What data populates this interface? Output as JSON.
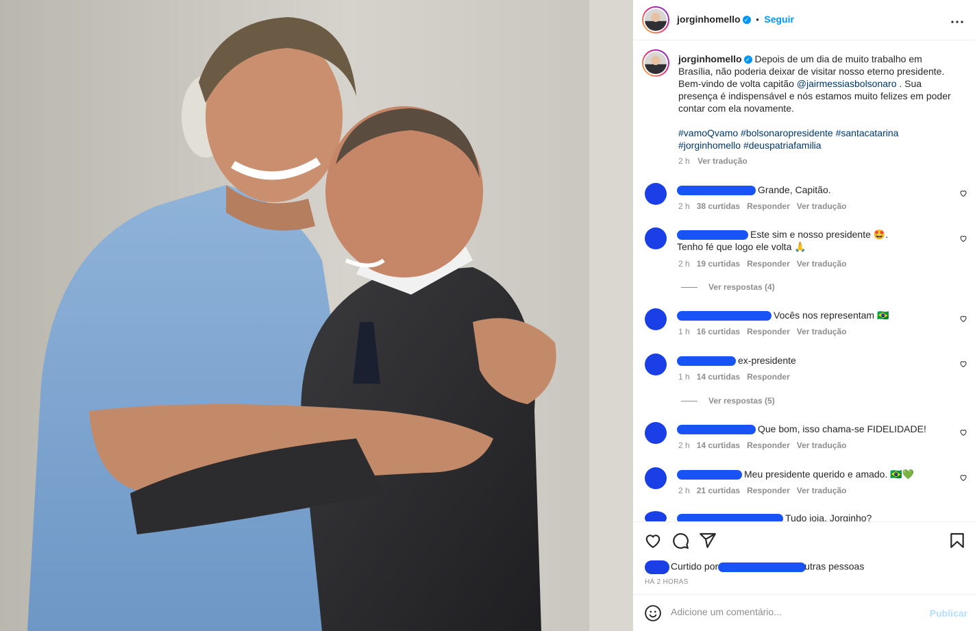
{
  "post": {
    "username": "jorginhomello",
    "follow_label": "Seguir",
    "separator": "•",
    "more_label": "•••"
  },
  "caption": {
    "username": "jorginhomello",
    "text_before_mention": "Depois de um dia de muito trabalho em Brasília, não poderia deixar de visitar nosso eterno presidente. Bem-vindo de volta capitão ",
    "mention": "@jairmessiasbolsonaro",
    "text_after_mention": " . Sua presença é indispensável e nós estamos muito felizes em poder contar com ela novamente.",
    "hashtags": [
      "#vamoQvamo",
      "#bolsonaropresidente",
      "#santacatarina",
      "#jorginhomello",
      "#deuspatriafamilia"
    ],
    "time": "2 h",
    "translate_label": "Ver tradução"
  },
  "comments": [
    {
      "text": "Grande, Capitão.",
      "time": "2 h",
      "likes": "38 curtidas",
      "reply": "Responder",
      "translate": "Ver tradução"
    },
    {
      "text": "Este sim e nosso presidente 🤩. Tenho fé que logo ele volta 🙏",
      "time": "2 h",
      "likes": "19 curtidas",
      "reply": "Responder",
      "translate": "Ver tradução",
      "replies_label": "Ver respostas (4)"
    },
    {
      "text": "Vocês nos representam 🇧🇷",
      "time": "1 h",
      "likes": "16 curtidas",
      "reply": "Responder",
      "translate": "Ver tradução"
    },
    {
      "text": "ex-presidente",
      "time": "1 h",
      "likes": "14 curtidas",
      "reply": "Responder",
      "replies_label": "Ver respostas (5)"
    },
    {
      "text": "Que bom, isso chama-se FIDELIDADE!",
      "time": "2 h",
      "likes": "14 curtidas",
      "reply": "Responder",
      "translate": "Ver tradução"
    },
    {
      "text": "Meu presidente querido e amado. 🇧🇷💚",
      "time": "2 h",
      "likes": "21 curtidas",
      "reply": "Responder",
      "translate": "Ver tradução"
    },
    {
      "text": "Tudo joia, Jorginho?"
    }
  ],
  "likes_line": {
    "prefix": "Curtido por",
    "suffix": "utras pessoas",
    "timestamp": "HÁ 2 HORAS"
  },
  "add_comment": {
    "placeholder": "Adicione um comentário...",
    "publish_label": "Publicar"
  },
  "icons": [
    "heart-icon",
    "comment-icon",
    "share-icon",
    "bookmark-icon",
    "emoji-icon",
    "verified-icon",
    "more-options-icon"
  ],
  "colors": {
    "accent": "#0095f6",
    "link": "#00376b",
    "muted": "#8e8e8e",
    "redaction": "#1a53f5"
  }
}
